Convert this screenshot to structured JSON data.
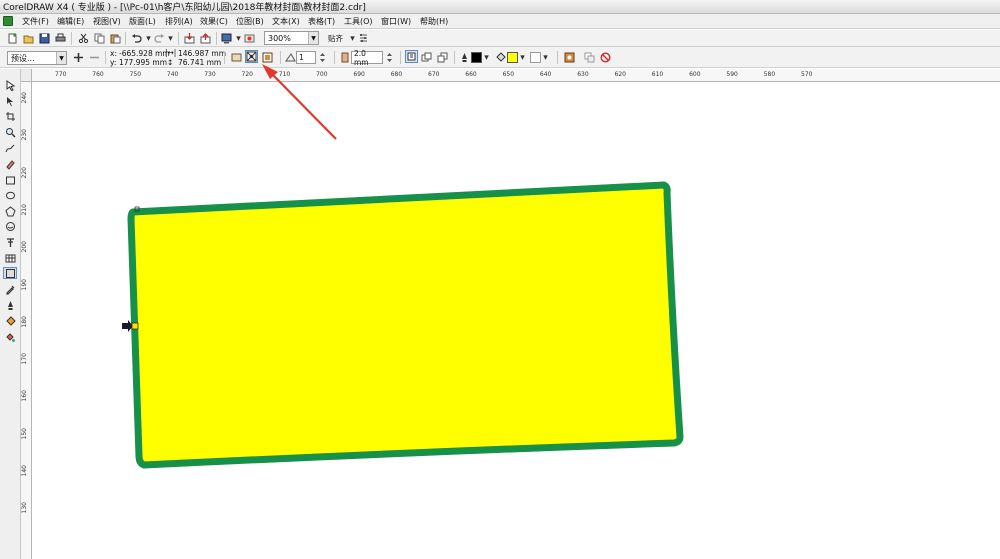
{
  "window": {
    "title": "CorelDRAW X4 ( 专业版 ) - [\\\\Pc-01\\h客户\\东阳幼儿园\\2018年教材封面\\教材封面2.cdr]"
  },
  "menu": {
    "items": [
      "文件(F)",
      "编辑(E)",
      "视图(V)",
      "版面(L)",
      "排列(A)",
      "效果(C)",
      "位图(B)",
      "文本(X)",
      "表格(T)",
      "工具(O)",
      "窗口(W)",
      "帮助(H)"
    ]
  },
  "toolbar": {
    "zoom": "300%",
    "snap_label": "贴齐"
  },
  "property_bar": {
    "preset": "预设...",
    "x_label": "x:",
    "x_value": "-665.928 mm",
    "y_label": "y:",
    "y_value": "177.995 mm",
    "width_value": "146.987 mm",
    "height_value": "76.741 mm",
    "sides_value": "1",
    "outline_value": "2.0 mm"
  },
  "ruler": {
    "h_ticks": [
      "770",
      "760",
      "750",
      "740",
      "730",
      "720",
      "710",
      "700",
      "690",
      "680",
      "670",
      "660",
      "650",
      "640",
      "630",
      "620",
      "610",
      "600",
      "590",
      "580",
      "570"
    ],
    "v_ticks": [
      "240",
      "230",
      "220",
      "210",
      "200",
      "190",
      "180",
      "170",
      "160",
      "150",
      "140",
      "130"
    ]
  },
  "colors": {
    "shape_fill": "#ffff00",
    "shape_outline": "#17904a",
    "annotation_arrow": "#e03a2f"
  }
}
